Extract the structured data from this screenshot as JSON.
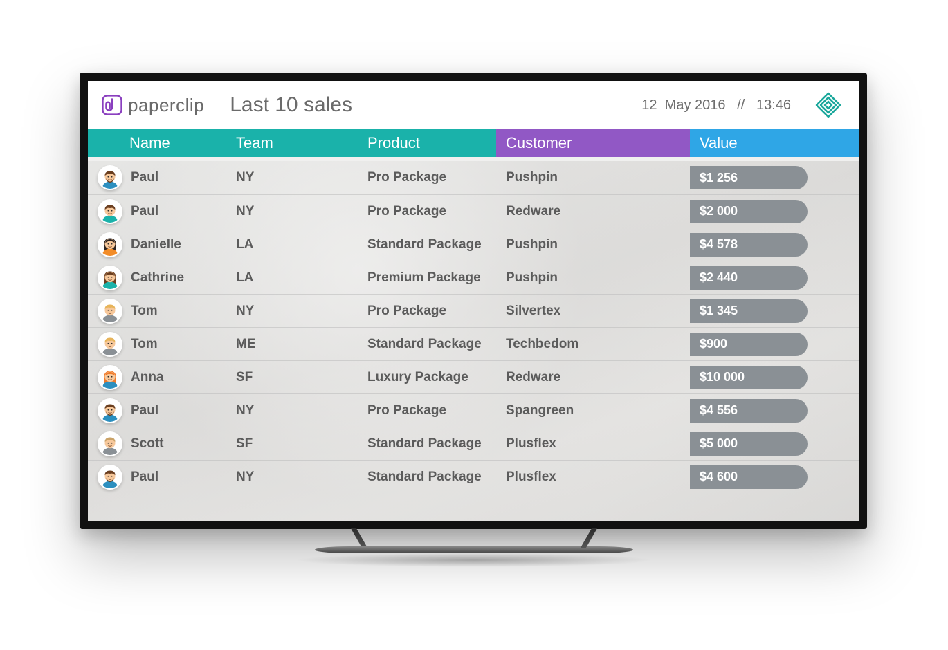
{
  "brand": {
    "name": "paperclip"
  },
  "header": {
    "title": "Last 10 sales",
    "datetime": "12  May 2016   //   13:46"
  },
  "columns": {
    "name": "Name",
    "team": "Team",
    "product": "Product",
    "customer": "Customer",
    "value": "Value"
  },
  "colors": {
    "teal": "#1ab2aa",
    "purple": "#9158c5",
    "blue": "#2fa6e6",
    "pill": "#8a9095"
  },
  "rows": [
    {
      "name": "Paul",
      "team": "NY",
      "product": "Pro Package",
      "customer": "Pushpin",
      "value": "$1 256",
      "avatar": "m-brown-beard"
    },
    {
      "name": "Paul",
      "team": "NY",
      "product": "Pro Package",
      "customer": "Redware",
      "value": "$2 000",
      "avatar": "m-brown-short"
    },
    {
      "name": "Danielle",
      "team": "LA",
      "product": "Standard Package",
      "customer": "Pushpin",
      "value": "$4 578",
      "avatar": "f-dark-bob"
    },
    {
      "name": "Cathrine",
      "team": "LA",
      "product": "Premium Package",
      "customer": "Pushpin",
      "value": "$2 440",
      "avatar": "f-brown-long"
    },
    {
      "name": "Tom",
      "team": "NY",
      "product": "Pro Package",
      "customer": "Silvertex",
      "value": "$1 345",
      "avatar": "m-blond-short"
    },
    {
      "name": "Tom",
      "team": "ME",
      "product": "Standard Package",
      "customer": "Techbedom",
      "value": "$900",
      "avatar": "m-blond-short"
    },
    {
      "name": "Anna",
      "team": "SF",
      "product": "Luxury Package",
      "customer": "Redware",
      "value": "$10 000",
      "avatar": "f-orange-long"
    },
    {
      "name": "Paul",
      "team": "NY",
      "product": "Pro Package",
      "customer": "Spangreen",
      "value": "$4 556",
      "avatar": "m-brown-beard"
    },
    {
      "name": "Scott",
      "team": "SF",
      "product": "Standard Package",
      "customer": "Plusflex",
      "value": "$5 000",
      "avatar": "m-light-short"
    },
    {
      "name": "Paul",
      "team": "NY",
      "product": "Standard Package",
      "customer": "Plusflex",
      "value": "$4 600",
      "avatar": "m-brown-beard"
    }
  ]
}
